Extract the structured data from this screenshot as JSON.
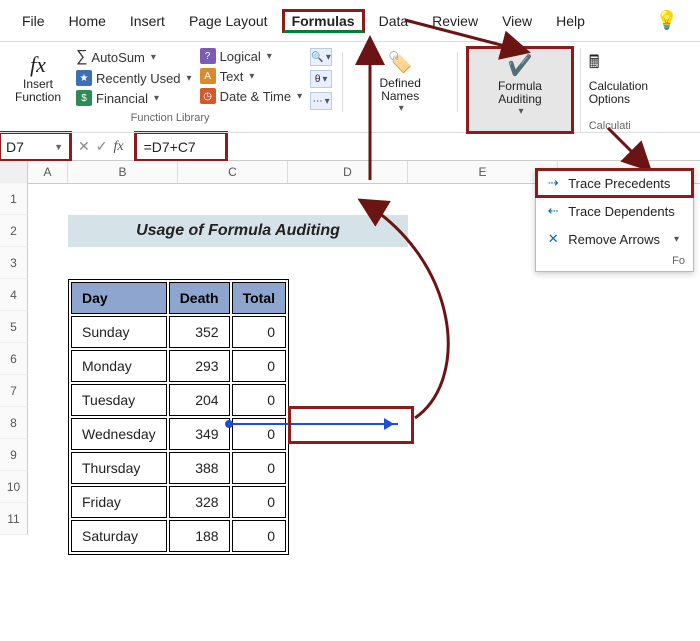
{
  "menu": {
    "file": "File",
    "home": "Home",
    "insert": "Insert",
    "pagelayout": "Page Layout",
    "formulas": "Formulas",
    "data": "Data",
    "review": "Review",
    "view": "View",
    "help": "Help"
  },
  "ribbon": {
    "insert_function": "Insert Function",
    "autosum": "AutoSum",
    "recently_used": "Recently Used",
    "financial": "Financial",
    "logical": "Logical",
    "text": "Text",
    "date_time": "Date & Time",
    "function_library": "Function Library",
    "defined_names": "Defined Names",
    "formula_auditing": "Formula Auditing",
    "calculation_options": "Calculation Options",
    "calculation_group": "Calculati"
  },
  "dropdown": {
    "trace_precedents": "Trace Precedents",
    "trace_dependents": "Trace Dependents",
    "remove_arrows": "Remove Arrows",
    "footer": "Fo"
  },
  "formulabar": {
    "cellref": "D7",
    "formula": "=D7+C7"
  },
  "columns": [
    "A",
    "B",
    "C",
    "D",
    "E"
  ],
  "rows": [
    "1",
    "2",
    "3",
    "4",
    "5",
    "6",
    "7",
    "8",
    "9",
    "10",
    "11"
  ],
  "title": "Usage of Formula Auditing",
  "table": {
    "headers": {
      "day": "Day",
      "death": "Death",
      "total": "Total"
    },
    "rows": [
      {
        "day": "Sunday",
        "death": "352",
        "total": "0"
      },
      {
        "day": "Monday",
        "death": "293",
        "total": "0"
      },
      {
        "day": "Tuesday",
        "death": "204",
        "total": "0"
      },
      {
        "day": "Wednesday",
        "death": "349",
        "total": "0"
      },
      {
        "day": "Thursday",
        "death": "388",
        "total": "0"
      },
      {
        "day": "Friday",
        "death": "328",
        "total": "0"
      },
      {
        "day": "Saturday",
        "death": "188",
        "total": "0"
      }
    ]
  }
}
